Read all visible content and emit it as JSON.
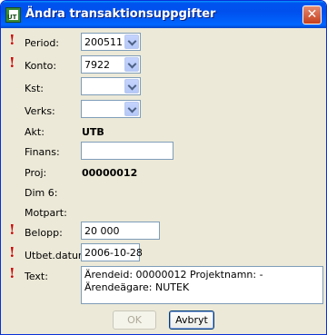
{
  "window": {
    "title": "Ändra transaktionsuppgifter",
    "app_icon_label": "UT"
  },
  "fields": {
    "period": {
      "label": "Period:",
      "value": "200511"
    },
    "konto": {
      "label": "Konto:",
      "value": "7922"
    },
    "kst": {
      "label": "Kst:",
      "value": ""
    },
    "verks": {
      "label": "Verks:",
      "value": ""
    },
    "akt": {
      "label": "Akt:",
      "value": "UTB"
    },
    "finans": {
      "label": "Finans:",
      "value": ""
    },
    "proj": {
      "label": "Proj:",
      "value": "00000012"
    },
    "dim6": {
      "label": "Dim 6:",
      "value": ""
    },
    "motpart": {
      "label": "Motpart:",
      "value": ""
    },
    "belopp": {
      "label": "Belopp:",
      "value": "20 000"
    },
    "utbet_datum": {
      "label": "Utbet.datum:",
      "value": "2006-10-28"
    },
    "text": {
      "label": "Text:",
      "value": "Ärendeid: 00000012 Projektnamn: - Ärendeägare: NUTEK"
    }
  },
  "required_marker": "!",
  "buttons": {
    "ok": "OK",
    "cancel": "Avbryt"
  },
  "colors": {
    "title_bar": "#0055ea",
    "required": "#cc0000",
    "dialog_bg": "#ece9d8"
  }
}
